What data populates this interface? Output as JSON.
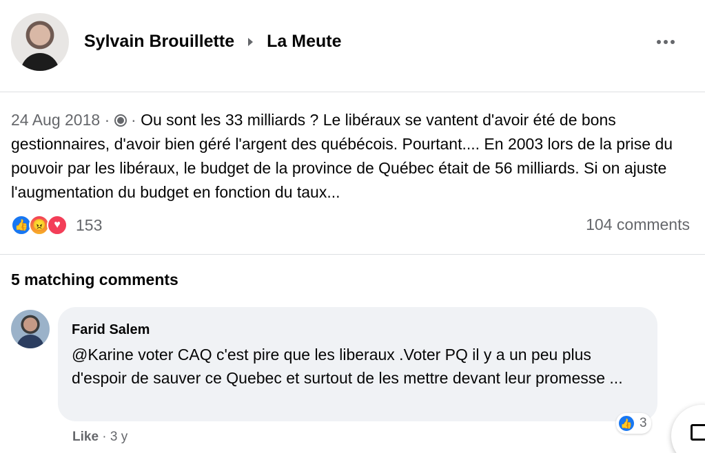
{
  "header": {
    "author": "Sylvain Brouillette",
    "group": "La Meute"
  },
  "post": {
    "date": "24 Aug 2018",
    "sep1": " · ",
    "sep2": " · ",
    "privacy_icon": "friends-icon",
    "text": "Ou sont les 33 milliards ? Le libéraux se vantent d'avoir été de bons gestionnaires, d'avoir bien géré l'argent des québécois. Pourtant.... En 2003 lors de la prise du pouvoir par les libéraux, le budget de la province de Québec était de 56 milliards. Si on ajuste l'augmentation du budget en fonction du taux...",
    "reactions_count": "153",
    "comments_count": "104 comments"
  },
  "matching": {
    "label": "5 matching comments"
  },
  "comment": {
    "author": "Farid Salem",
    "text": "@Karine voter CAQ c'est pire que les liberaux .Voter PQ il y a un peu plus d'espoir de sauver ce Quebec et surtout de les mettre devant leur promesse ...",
    "reaction_count": "3",
    "like_label": "Like",
    "time": "3 y",
    "time_sep": " · "
  },
  "colors": {
    "accent": "#1877f2",
    "secondary_text": "#65676b",
    "bubble": "#f0f2f5"
  }
}
